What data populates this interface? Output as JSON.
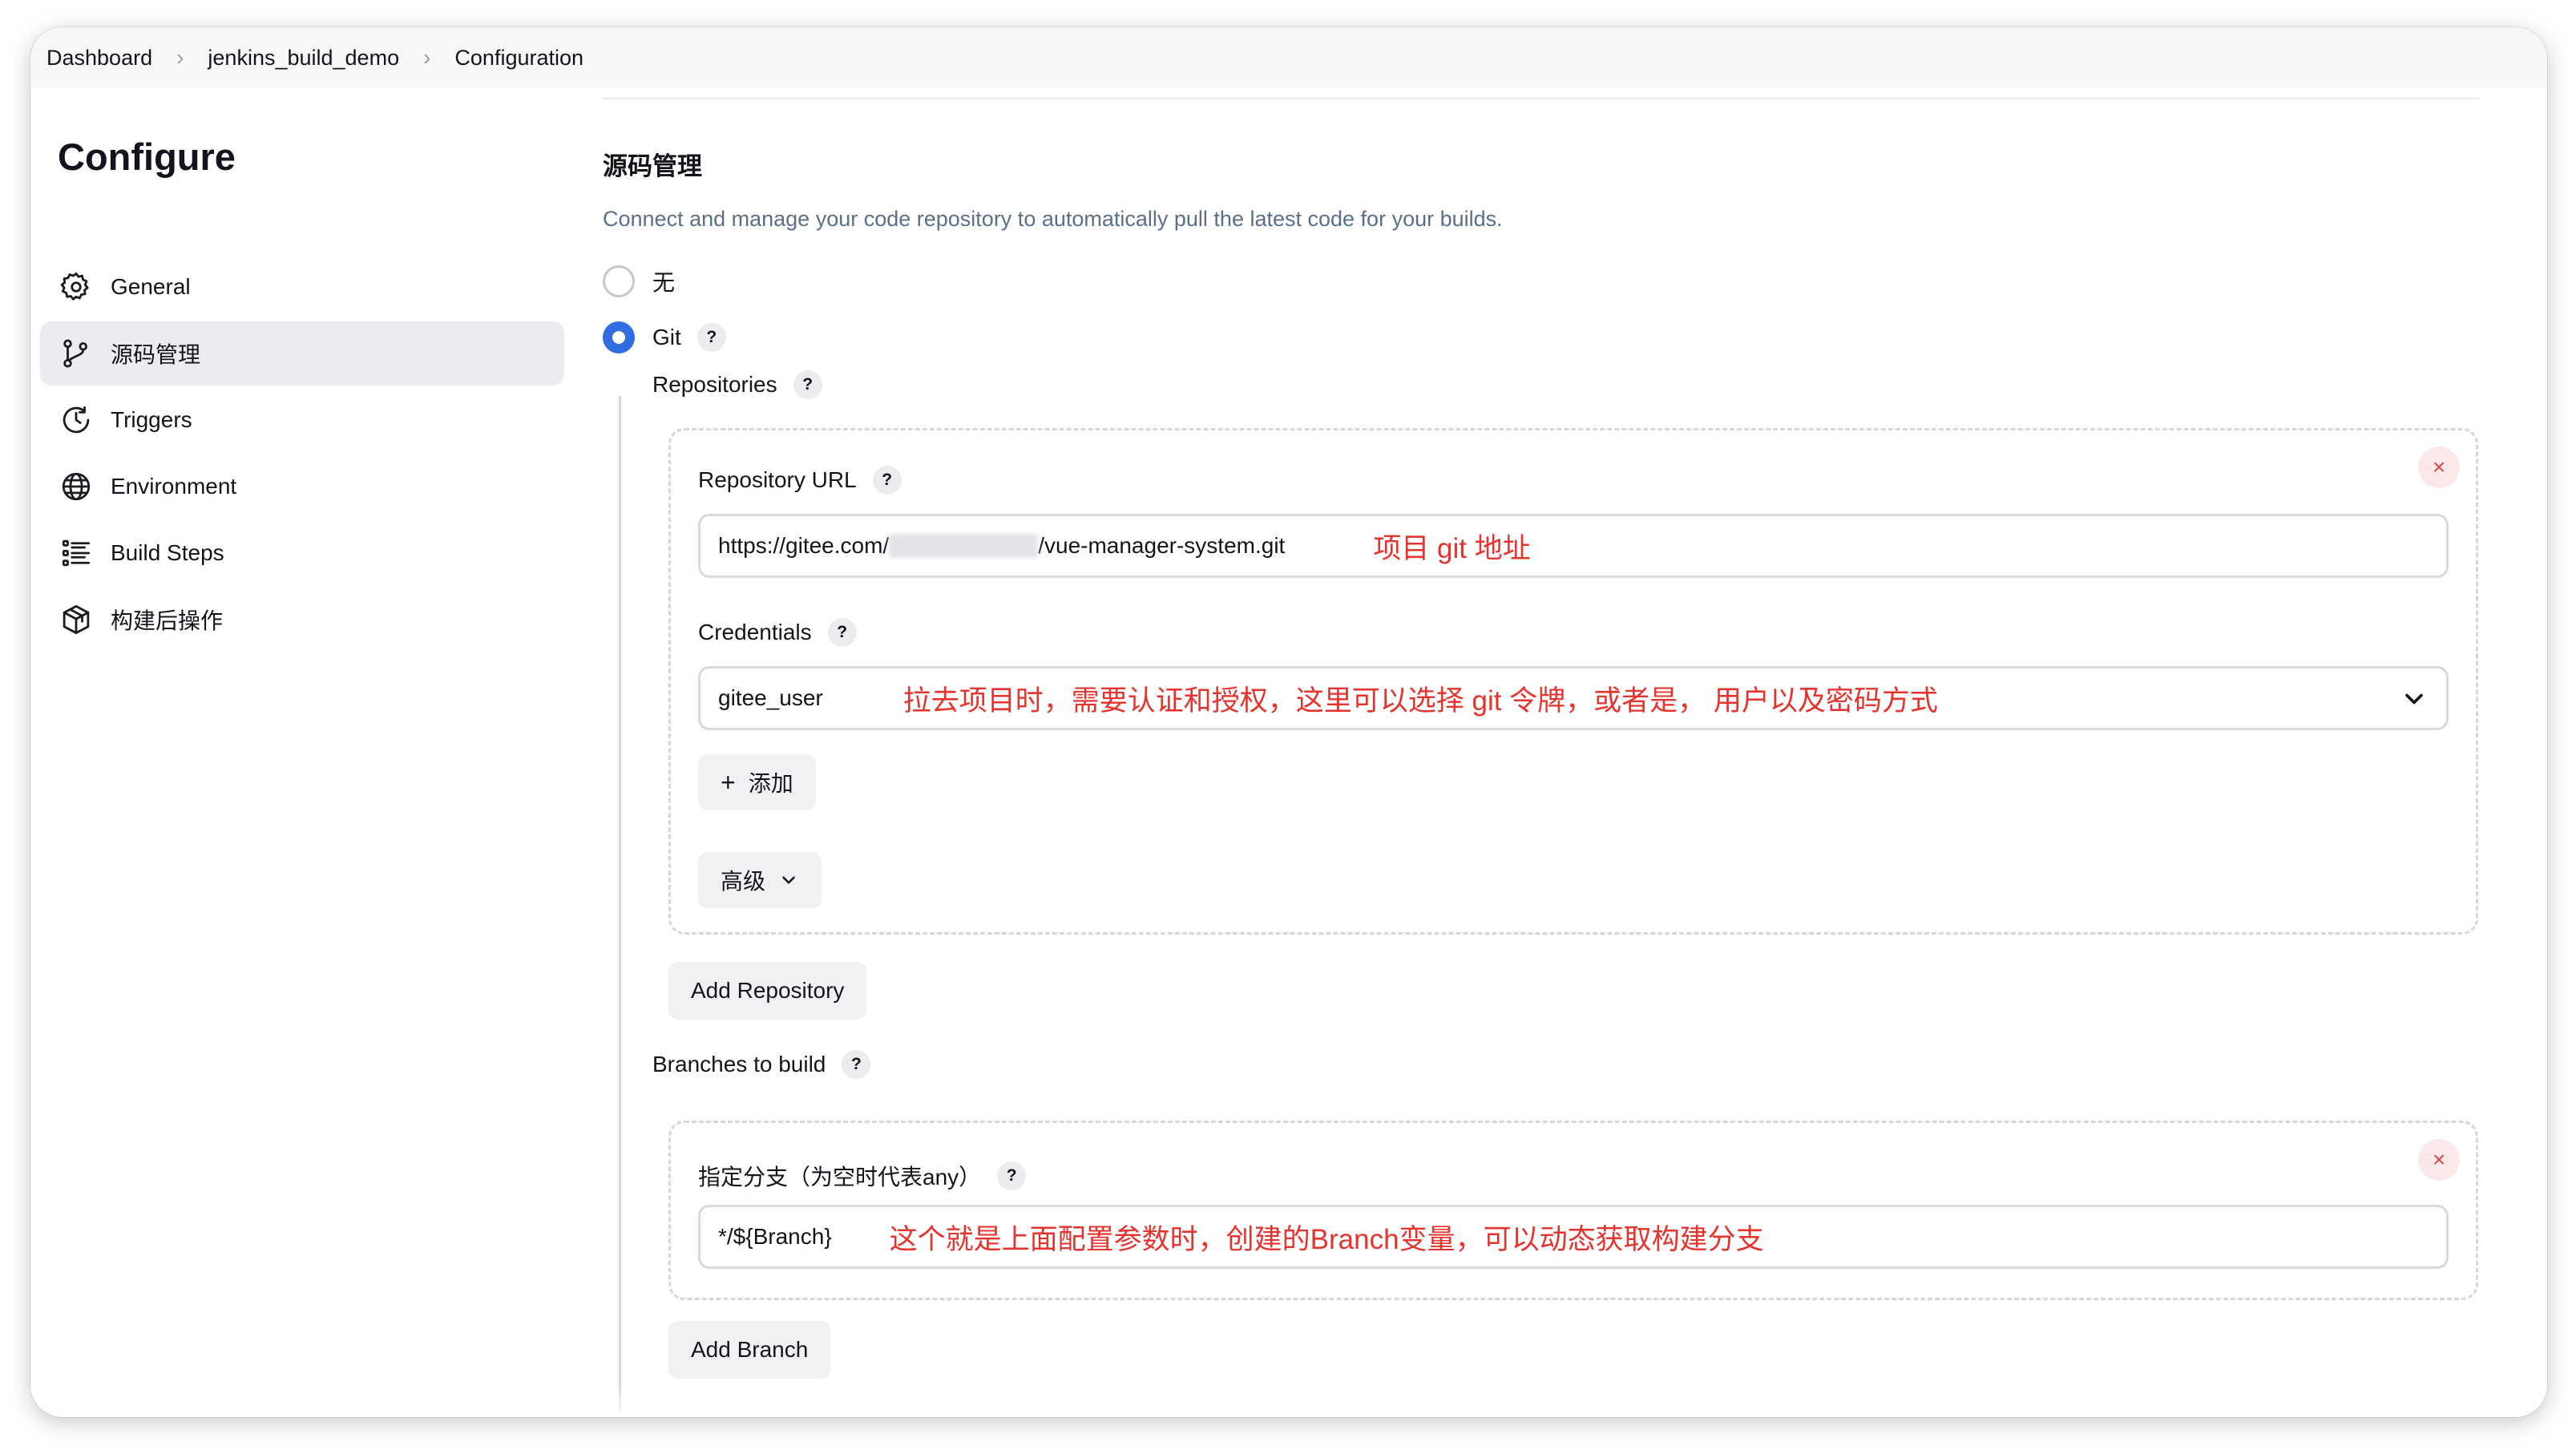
{
  "breadcrumb": [
    "Dashboard",
    "jenkins_build_demo",
    "Configuration"
  ],
  "sidebar": {
    "title": "Configure",
    "items": [
      {
        "label": "General",
        "icon": "gear-icon"
      },
      {
        "label": "源码管理",
        "icon": "branch-icon",
        "active": true
      },
      {
        "label": "Triggers",
        "icon": "clock-icon"
      },
      {
        "label": "Environment",
        "icon": "globe-icon"
      },
      {
        "label": "Build Steps",
        "icon": "list-icon"
      },
      {
        "label": "构建后操作",
        "icon": "package-icon"
      }
    ]
  },
  "scm": {
    "title": "源码管理",
    "description": "Connect and manage your code repository to automatically pull the latest code for your builds.",
    "option_none": "无",
    "option_git": "Git",
    "selected": "Git",
    "help": "?",
    "repositories_label": "Repositories",
    "repo_url_label": "Repository URL",
    "repo_url_prefix": "https://gitee.com/",
    "repo_url_suffix": "/vue-manager-system.git",
    "repo_url_annotation": "项目 git 地址",
    "credentials_label": "Credentials",
    "credentials_value": "gitee_user",
    "credentials_annotation": "拉去项目时，需要认证和授权，这里可以选择 git 令牌，或者是， 用户以及密码方式",
    "add_label": "添加",
    "advanced_label": "高级",
    "add_repository_label": "Add Repository",
    "branches_label": "Branches to build",
    "branch_specifier_label": "指定分支（为空时代表any）",
    "branch_value": "*/${Branch}",
    "branch_annotation": "这个就是上面配置参数时，创建的Branch变量，可以动态获取构建分支",
    "add_branch_label": "Add Branch",
    "close_symbol": "×"
  },
  "colors": {
    "accent": "#2f6de0",
    "annotation": "#e5332d",
    "description": "#5b6f8a",
    "close": "#e0494d"
  }
}
